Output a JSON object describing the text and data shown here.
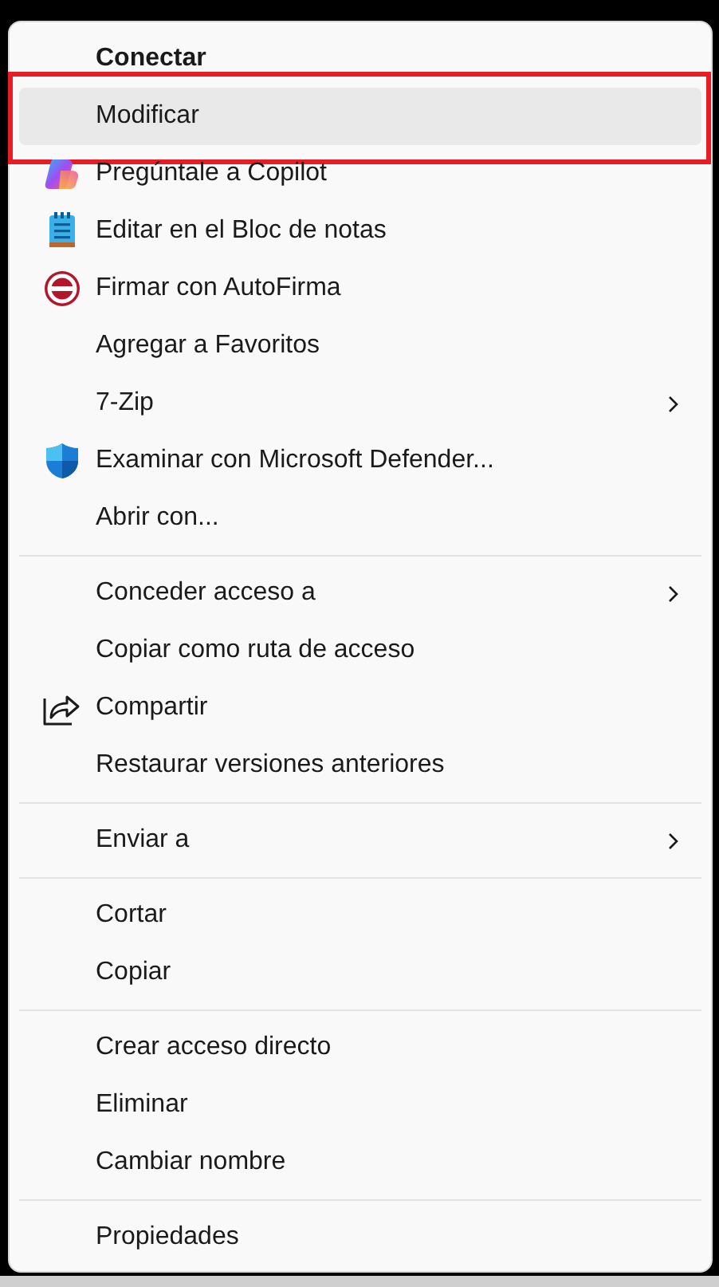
{
  "menu": {
    "groups": [
      {
        "items": [
          {
            "label": "Conectar",
            "default": true,
            "hovered": false,
            "outlined": false,
            "submenu": false
          },
          {
            "label": "Modificar",
            "default": false,
            "hovered": true,
            "outlined": true,
            "submenu": false
          },
          {
            "label": "Pregúntale a Copilot",
            "default": false,
            "hovered": false,
            "outlined": false,
            "submenu": false
          },
          {
            "label": "Editar en el Bloc de notas",
            "default": false,
            "hovered": false,
            "outlined": false,
            "submenu": false
          },
          {
            "label": "Firmar con AutoFirma",
            "default": false,
            "hovered": false,
            "outlined": false,
            "submenu": false
          },
          {
            "label": "Agregar a Favoritos",
            "default": false,
            "hovered": false,
            "outlined": false,
            "submenu": false
          },
          {
            "label": "7-Zip",
            "default": false,
            "hovered": false,
            "outlined": false,
            "submenu": true
          },
          {
            "label": "Examinar con Microsoft Defender...",
            "default": false,
            "hovered": false,
            "outlined": false,
            "submenu": false
          },
          {
            "label": "Abrir con...",
            "default": false,
            "hovered": false,
            "outlined": false,
            "submenu": false
          }
        ]
      },
      {
        "items": [
          {
            "label": "Conceder acceso a",
            "default": false,
            "hovered": false,
            "outlined": false,
            "submenu": true
          },
          {
            "label": "Copiar como ruta de acceso",
            "default": false,
            "hovered": false,
            "outlined": false,
            "submenu": false
          },
          {
            "label": "Compartir",
            "default": false,
            "hovered": false,
            "outlined": false,
            "submenu": false
          },
          {
            "label": "Restaurar versiones anteriores",
            "default": false,
            "hovered": false,
            "outlined": false,
            "submenu": false
          }
        ]
      },
      {
        "items": [
          {
            "label": "Enviar a",
            "default": false,
            "hovered": false,
            "outlined": false,
            "submenu": true
          }
        ]
      },
      {
        "items": [
          {
            "label": "Cortar",
            "default": false,
            "hovered": false,
            "outlined": false,
            "submenu": false
          },
          {
            "label": "Copiar",
            "default": false,
            "hovered": false,
            "outlined": false,
            "submenu": false
          }
        ]
      },
      {
        "items": [
          {
            "label": "Crear acceso directo",
            "default": false,
            "hovered": false,
            "outlined": false,
            "submenu": false
          },
          {
            "label": "Eliminar",
            "default": false,
            "hovered": false,
            "outlined": false,
            "submenu": false
          },
          {
            "label": "Cambiar nombre",
            "default": false,
            "hovered": false,
            "outlined": false,
            "submenu": false
          }
        ]
      },
      {
        "items": [
          {
            "label": "Propiedades",
            "default": false,
            "hovered": false,
            "outlined": false,
            "submenu": false
          }
        ]
      }
    ]
  }
}
